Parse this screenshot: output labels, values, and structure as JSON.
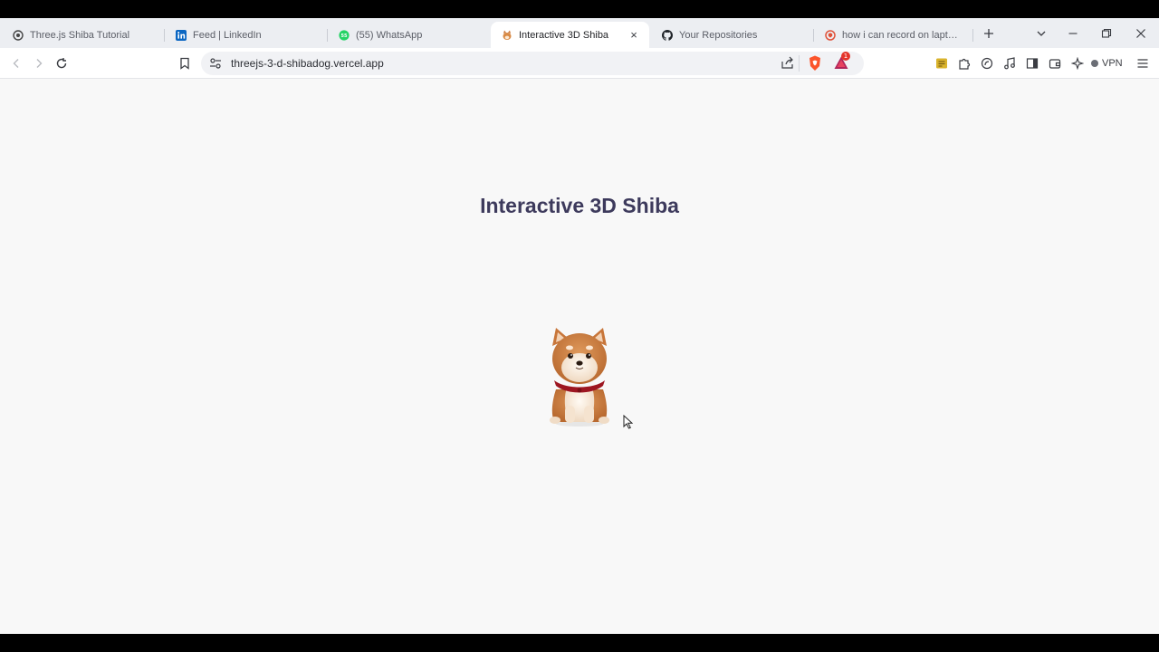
{
  "browser": {
    "tabs": [
      {
        "label": "Three.js Shiba Tutorial",
        "icon": "threejs-icon",
        "active": false
      },
      {
        "label": "Feed | LinkedIn",
        "icon": "linkedin-icon",
        "active": false
      },
      {
        "label": "(55) WhatsApp",
        "icon": "whatsapp-icon",
        "active": false
      },
      {
        "label": "Interactive 3D Shiba",
        "icon": "shiba-icon",
        "active": true
      },
      {
        "label": "Your Repositories",
        "icon": "github-icon",
        "active": false
      },
      {
        "label": "how i can record on laptop - B",
        "icon": "brave-search-icon",
        "active": false
      }
    ],
    "tab_close": "×",
    "url": "threejs-3-d-shibadog.vercel.app",
    "vpn_label": "VPN",
    "rewards_badge": "1"
  },
  "page": {
    "title": "Interactive 3D Shiba"
  },
  "colors": {
    "page_bg": "#f8f8f8",
    "title": "#3d3a5c",
    "brave_orange": "#fb542b"
  }
}
